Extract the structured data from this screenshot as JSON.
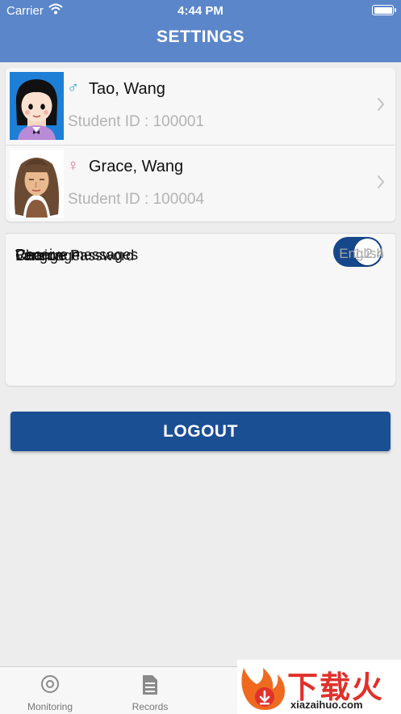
{
  "status_bar": {
    "carrier": "Carrier",
    "time": "4:44 PM"
  },
  "header": {
    "title": "SETTINGS"
  },
  "students": [
    {
      "gender_symbol": "♂",
      "name": "Tao, Wang",
      "student_id": "Student ID : 100001"
    },
    {
      "gender_symbol": "♀",
      "name": "Grace, Wang",
      "student_id": "Student ID : 100004"
    }
  ],
  "settings": {
    "receive_messages": {
      "label": "Receive messages",
      "enabled": true
    },
    "change_password": {
      "label": "Change Password"
    },
    "version": {
      "label": "Version",
      "value": "1.2.4"
    },
    "language": {
      "label": "Language",
      "value": "English"
    }
  },
  "logout_label": "LOGOUT",
  "tabs": [
    {
      "label": "Monitoring",
      "icon": "monitoring-icon"
    },
    {
      "label": "Records",
      "icon": "records-icon"
    },
    {
      "label": "M",
      "icon": "messages-icon"
    },
    {
      "label": "",
      "icon": ""
    }
  ],
  "watermark": {
    "text": "下载火",
    "url": "xiazaihuo.com"
  },
  "colors": {
    "header_bg": "#5b86c9",
    "toggle_on": "#16478a",
    "logout_bg": "#1b4f94",
    "male": "#2ea0cf",
    "female": "#e0717d",
    "watermark": "#e0312b"
  }
}
